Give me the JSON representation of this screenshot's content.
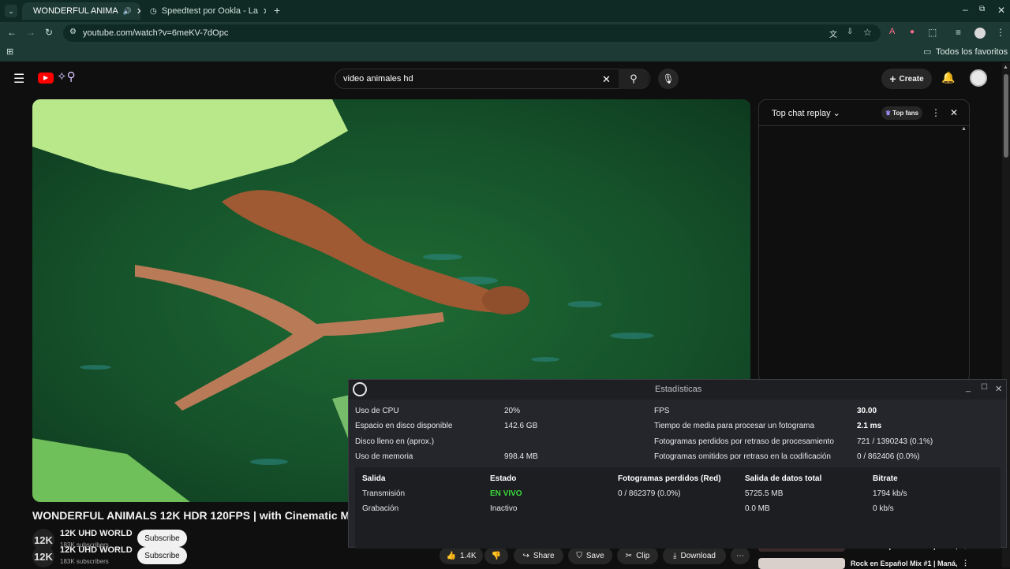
{
  "browser": {
    "tabs": [
      {
        "title": "WONDERFUL ANIMA",
        "active": true
      },
      {
        "title": "Speedtest por Ookla - La",
        "active": false
      }
    ],
    "url": "youtube.com/watch?v=6meKV-7dOpc",
    "bookmarks_label": "Todos los favoritos"
  },
  "youtube": {
    "search_value": "video animales hd",
    "create_label": "Create",
    "video_title": "WONDERFUL ANIMALS 12K HDR 120FPS | with Cinematic Music (C",
    "channels": [
      {
        "avatar": "12K",
        "name": "12K UHD WORLD",
        "subs": "183K subscribers",
        "subscribe": "Subscribe"
      },
      {
        "avatar": "12K",
        "name": "12K UHD WORLD",
        "subs": "183K subscribers",
        "subscribe": "Subscribe"
      }
    ],
    "actions": {
      "likes": "1.4K",
      "share": "Share",
      "save": "Save",
      "clip": "Clip",
      "download": "Download"
    },
    "chat": {
      "title": "Top chat replay",
      "top_fans": "Top fans"
    },
    "recommendations": [
      {
        "title": "Rock en Español Mix #1 | Maná,"
      },
      {
        "title": "Rock en Español Mix #1 | Maná,"
      }
    ]
  },
  "stats": {
    "window_title": "Estadísticas",
    "left": [
      {
        "label": "Uso de CPU",
        "value": "20%"
      },
      {
        "label": "Espacio en disco disponible",
        "value": "142.6 GB"
      },
      {
        "label": "Disco lleno en (aprox.)",
        "value": ""
      },
      {
        "label": "Uso de memoria",
        "value": "998.4 MB"
      }
    ],
    "right": [
      {
        "label": "FPS",
        "value": "30.00"
      },
      {
        "label": "Tiempo de media para procesar un fotograma",
        "value": "2.1 ms"
      },
      {
        "label": "Fotogramas perdidos por retraso de procesamiento",
        "value": "721 / 1390243 (0.1%)"
      },
      {
        "label": "Fotogramas omitidos por retraso en la codificación",
        "value": "0 / 862406 (0.0%)"
      }
    ],
    "output_headers": [
      "Salida",
      "Estado",
      "Fotogramas perdidos (Red)",
      "Salida de datos total",
      "Bitrate"
    ],
    "output_rows": [
      [
        "Transmisión",
        "EN VIVO",
        "0 / 862379 (0.0%)",
        "5725.5 MB",
        "1794 kb/s"
      ],
      [
        "Grabación",
        "Inactivo",
        "",
        "0.0 MB",
        "0 kb/s"
      ]
    ]
  }
}
